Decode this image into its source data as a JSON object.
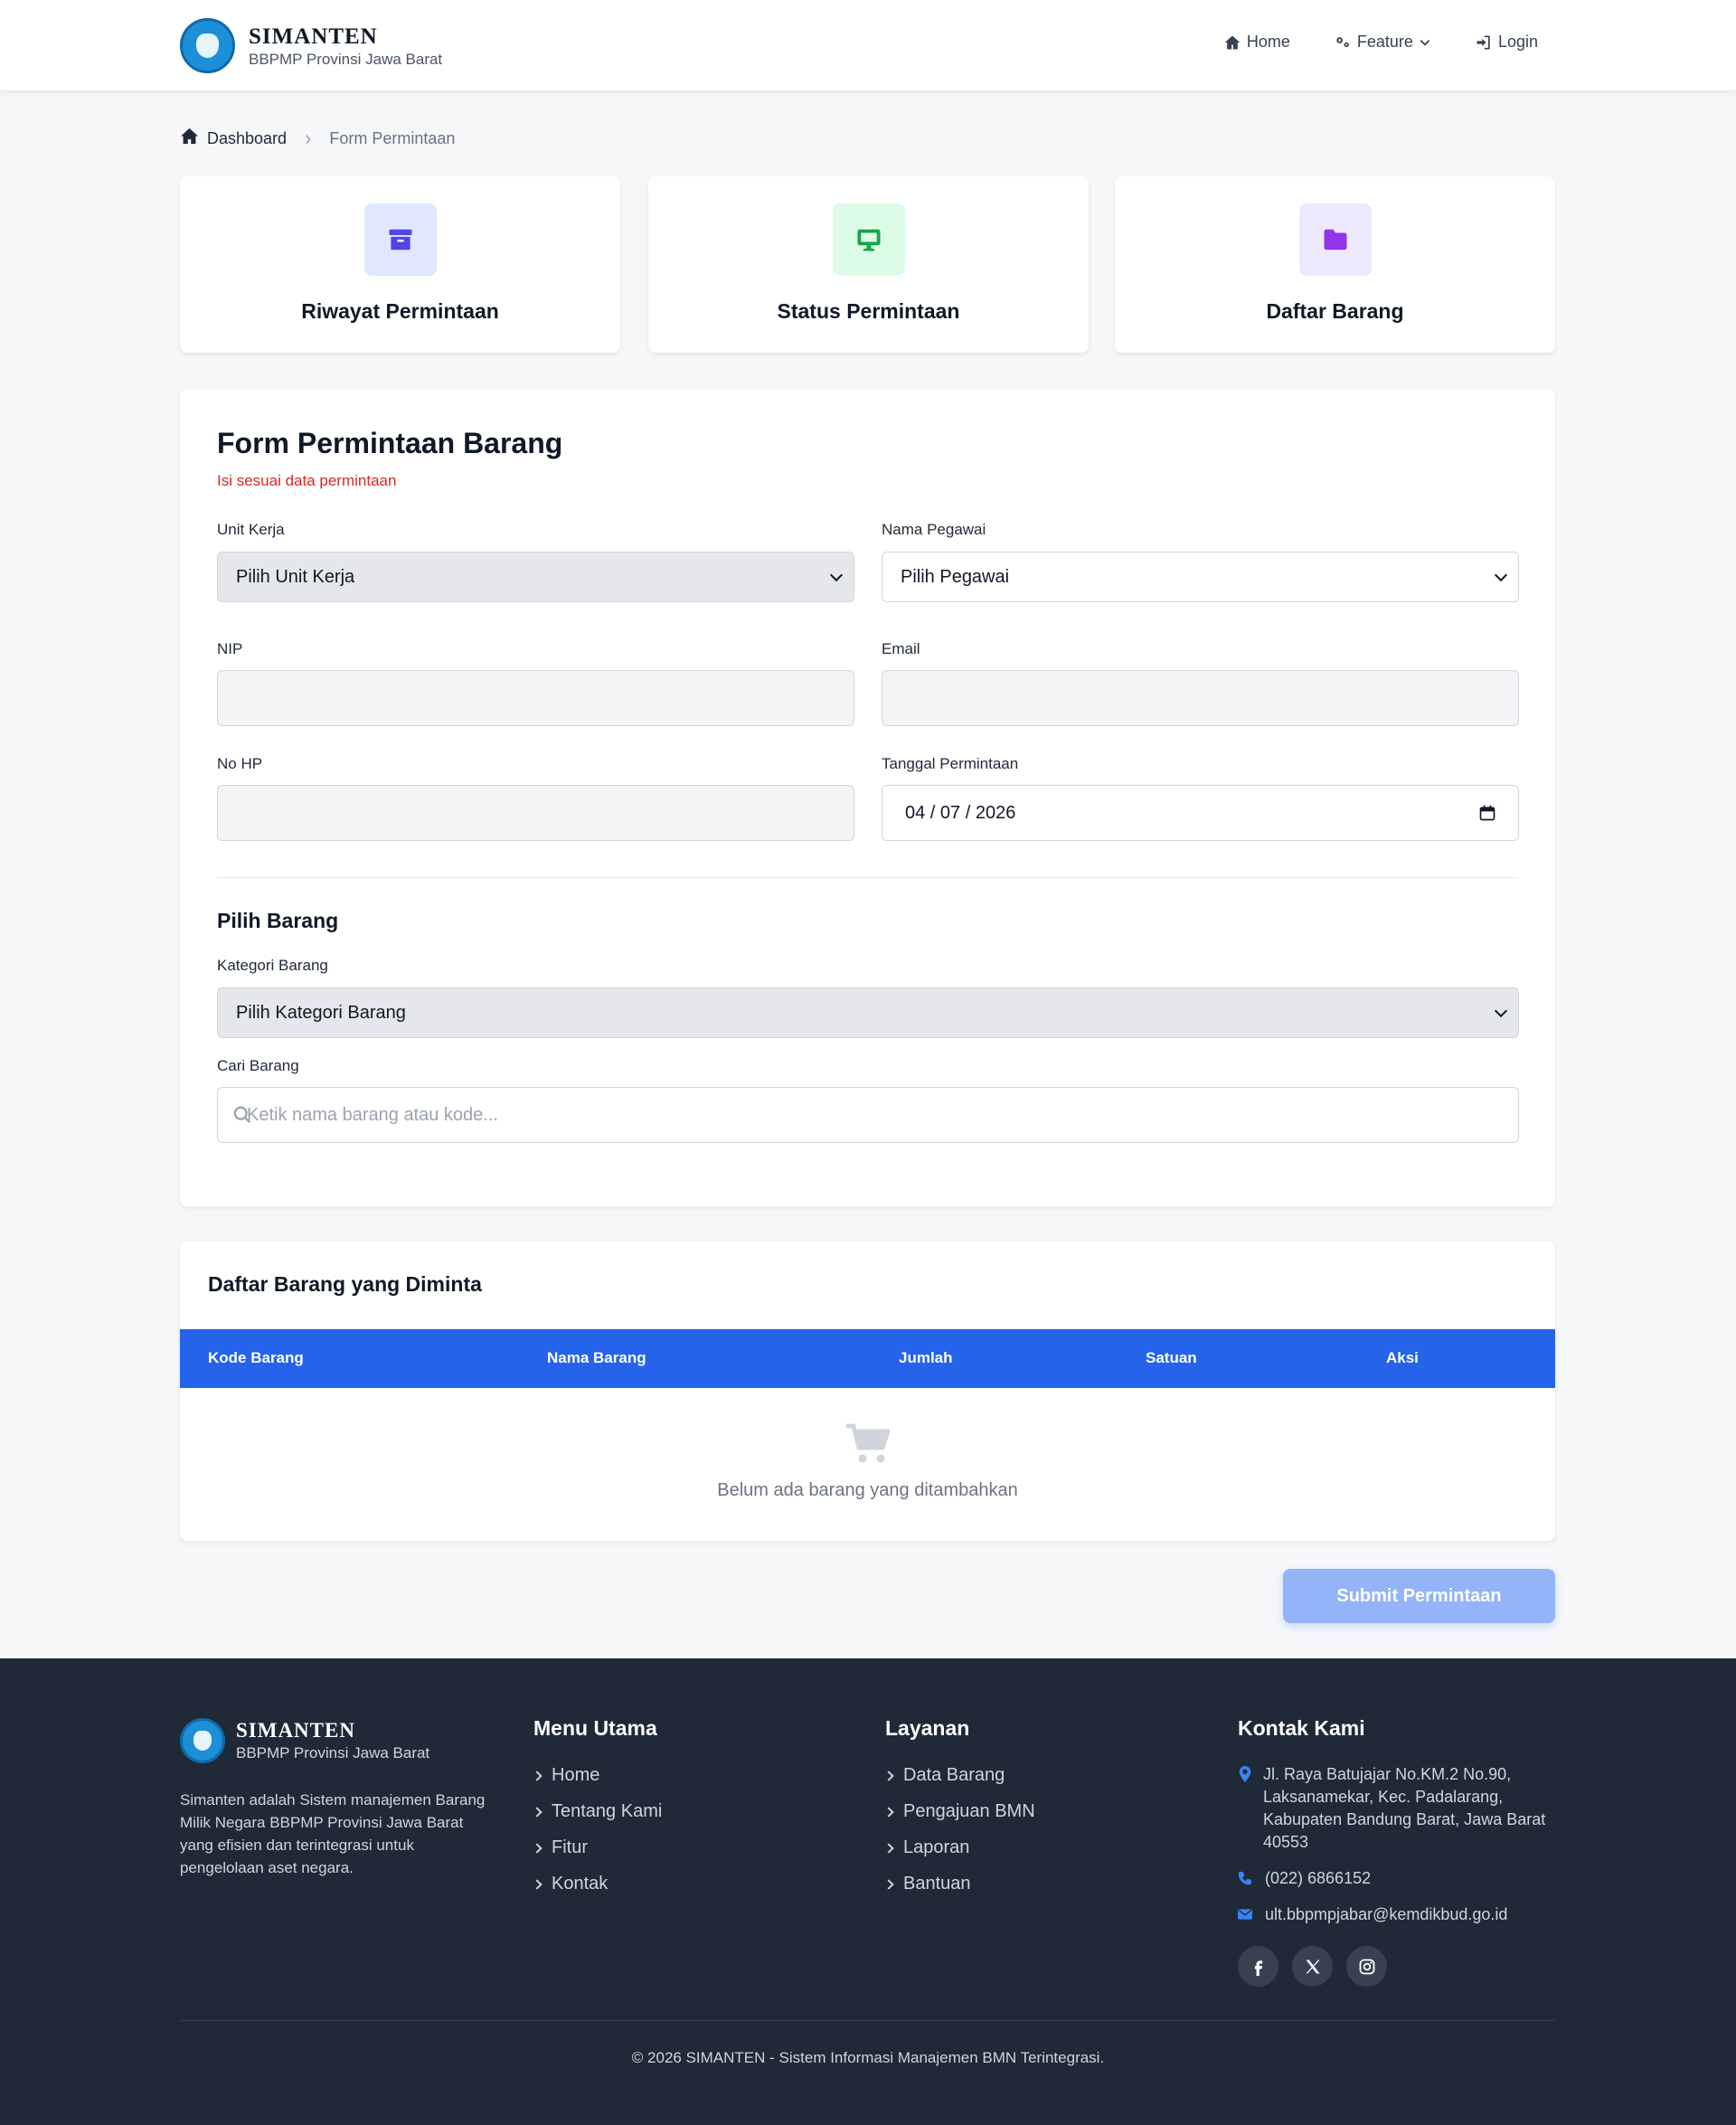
{
  "header": {
    "brand_title": "SIMANTEN",
    "brand_subtitle": "BBPMP Provinsi Jawa Barat",
    "nav": {
      "home": "Home",
      "feature": "Feature",
      "login": "Login"
    }
  },
  "breadcrumb": {
    "home": "Dashboard",
    "current": "Form Permintaan"
  },
  "quick_cards": [
    {
      "label": "Riwayat Permintaan",
      "icon": "archive-icon",
      "bg": "#e0e7ff",
      "color": "#4f46e5"
    },
    {
      "label": "Status Permintaan",
      "icon": "monitor-icon",
      "bg": "#dcfce7",
      "color": "#16a34a"
    },
    {
      "label": "Daftar Barang",
      "icon": "folder-icon",
      "bg": "#ede9fe",
      "color": "#9333ea"
    }
  ],
  "form": {
    "title": "Form Permintaan Barang",
    "subtitle": "Isi sesuai data permintaan",
    "unit_kerja_label": "Unit Kerja",
    "unit_kerja_value": "Pilih Unit Kerja",
    "nama_pegawai_label": "Nama Pegawai",
    "nama_pegawai_value": "Pilih Pegawai",
    "nip_label": "NIP",
    "nip_value": "",
    "email_label": "Email",
    "email_value": "",
    "no_hp_label": "No HP",
    "no_hp_value": "",
    "tanggal_label": "Tanggal Permintaan",
    "tanggal_value": "04 / 07 / 2026",
    "section_title": "Pilih Barang",
    "kategori_label": "Kategori Barang",
    "kategori_value": "Pilih Kategori Barang",
    "cari_label": "Cari Barang",
    "cari_placeholder": "Ketik nama barang atau kode..."
  },
  "table": {
    "title": "Daftar Barang yang Diminta",
    "columns": [
      "Kode Barang",
      "Nama Barang",
      "Jumlah",
      "Satuan",
      "Aksi"
    ],
    "empty_text": "Belum ada barang yang ditambahkan"
  },
  "submit_label": "Submit Permintaan",
  "footer": {
    "brand_title": "SIMANTEN",
    "brand_subtitle": "BBPMP Provinsi Jawa Barat",
    "description": "Simanten adalah Sistem manajemen Barang Milik Negara BBPMP Provinsi Jawa Barat yang efisien dan terintegrasi untuk pengelolaan aset negara.",
    "menu_title": "Menu Utama",
    "menu_items": [
      "Home",
      "Tentang Kami",
      "Fitur",
      "Kontak"
    ],
    "layanan_title": "Layanan",
    "layanan_items": [
      "Data Barang",
      "Pengajuan BMN",
      "Laporan",
      "Bantuan"
    ],
    "kontak_title": "Kontak Kami",
    "address": "Jl. Raya Batujajar No.KM.2 No.90, Laksanamekar, Kec. Padalarang, Kabupaten Bandung Barat, Jawa Barat 40553",
    "phone": "(022) 6866152",
    "email": "ult.bbpmpjabar@kemdikbud.go.id",
    "social": [
      "facebook-icon",
      "x-icon",
      "instagram-icon"
    ],
    "copyright": "© 2026 SIMANTEN - Sistem Informasi Manajemen BMN Terintegrasi.",
    "accent": "#3b82f6"
  }
}
